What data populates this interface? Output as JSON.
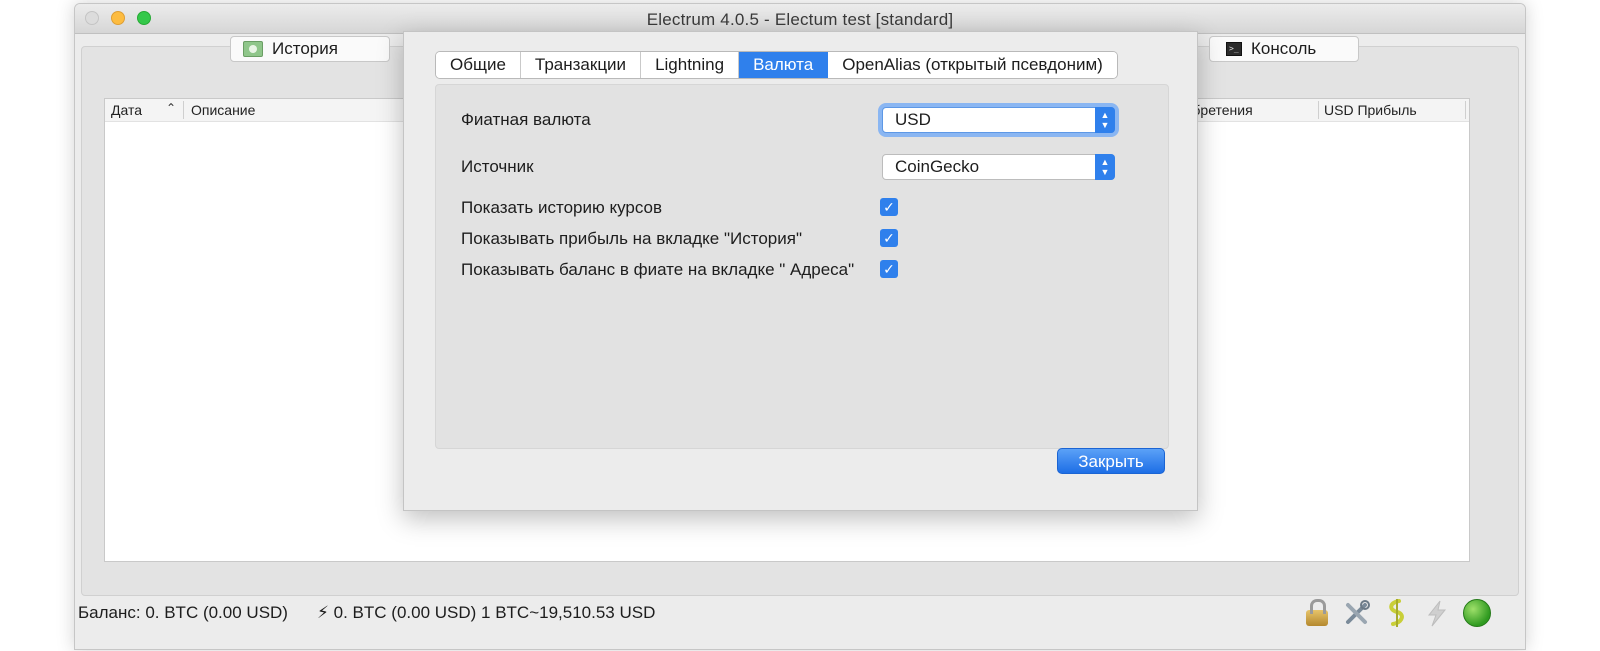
{
  "window": {
    "title": "Electrum 4.0.5  -  Electum test  [standard]"
  },
  "main_tabs": {
    "history": "История",
    "console": "Консоль"
  },
  "table": {
    "col_date": "Дата",
    "col_description": "Описание",
    "col_acquisition": "риобретения",
    "col_profit": "USD Прибыль"
  },
  "status": {
    "balance": "Баланс: 0. BTC (0.00 USD)",
    "lightning": "⚡ 0. BTC (0.00 USD) 1 BTC~19,510.53 USD"
  },
  "dialog": {
    "tabs": [
      "Общие",
      "Транзакции",
      "Lightning",
      "Валюта",
      "OpenAlias (открытый псевдоним)"
    ],
    "active_tab": "Валюта",
    "fiat_label": "Фиатная валюта",
    "fiat_value": "USD",
    "source_label": "Источник",
    "source_value": "CoinGecko",
    "option_history_rates": "Показать историю курсов",
    "option_history_rates_checked": true,
    "option_profit": "Показывать прибыль на вкладке \"История\"",
    "option_profit_checked": true,
    "option_fiat_balance": "Показывать баланс в фиате на вкладке \" Адреса\"",
    "option_fiat_balance_checked": true,
    "close_button": "Закрыть"
  },
  "icons": {
    "lock": "lock-icon",
    "preferences": "tools-icon",
    "seed": "seed-icon",
    "lightning": "lightning-icon",
    "network": "network-status-icon"
  },
  "colors": {
    "accent": "#2f80ec",
    "status_green": "#2f9a20"
  }
}
